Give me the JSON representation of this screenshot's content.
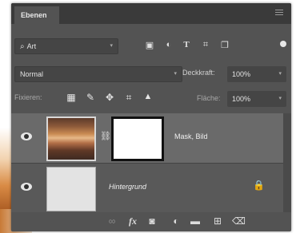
{
  "panel": {
    "tab_title": "Ebenen"
  },
  "filter": {
    "search_symbol": "⌕",
    "kind_label": "Art",
    "icons": [
      "image-filter-icon",
      "adjustment-filter-icon",
      "type-filter-icon",
      "shape-filter-icon",
      "smartobject-filter-icon"
    ]
  },
  "blend": {
    "mode": "Normal",
    "opacity_label": "Deckkraft:",
    "opacity_value": "100%"
  },
  "locks": {
    "label": "Fixieren:",
    "fill_label": "Fläche:",
    "fill_value": "100%"
  },
  "layers": [
    {
      "name": "Mask, Bild",
      "visible": true,
      "selected": true
    },
    {
      "name": "Hintergrund",
      "visible": true,
      "selected": false,
      "locked": true
    }
  ],
  "bottom_icons": [
    "link-layers-icon",
    "fx-icon",
    "add-mask-icon",
    "adjustment-layer-icon",
    "new-group-icon",
    "new-layer-icon",
    "delete-icon"
  ],
  "glyphs": {
    "caret": "▾",
    "fx": "fx",
    "trash": "🗑",
    "lock": "🔒"
  }
}
